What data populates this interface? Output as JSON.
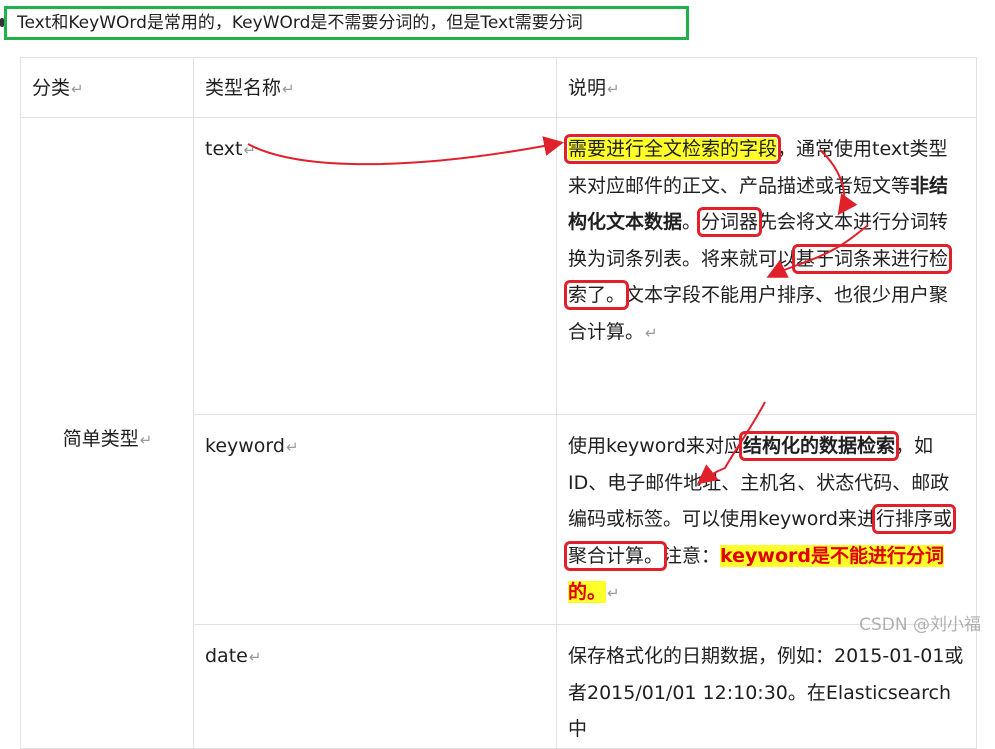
{
  "note": "Text和KeyWOrd是常用的，KeyWOrd是不需要分词的，但是Text需要分词",
  "table": {
    "headers": [
      "分类",
      "类型名称",
      "说明"
    ],
    "category": "简单类型",
    "rows": [
      {
        "name": "text",
        "desc": {
          "p1": "需要进行全文检索的字段",
          "p2": "，通常使用text类型来对应邮件的正文、产品描述或者短文等",
          "p3": "非结构化文本数据",
          "p4": "。",
          "p5": "分词器",
          "p6": "先会将文本进行分词转换为词条列表。将来就可以",
          "p7": "基于词条来进行检索了。",
          "p8": "文本字段不能用户排序、也很少用户聚合计算。"
        }
      },
      {
        "name": "keyword",
        "desc": {
          "p1": "使用keyword来对应",
          "p2": "结构化的数据检索",
          "p3": "，如ID、电子邮件地址、主机名、状态代码、邮政编码或标签。可以使用keyword来进",
          "p4": "行排序或聚合计算。",
          "p5": "注意：",
          "p6": "keyword是不能进行分词的。"
        }
      },
      {
        "name": "date",
        "desc": {
          "p1": "保存格式化的日期数据，例如：2015-01-01或者2015/01/01 12:10:30。在Elasticsearch中"
        }
      }
    ],
    "return_mark": "↵"
  },
  "watermark": "CSDN @刘小福",
  "colors": {
    "note_border": "#22b24c",
    "annotation_red": "#e0212b",
    "highlight": "#ffff2a"
  }
}
